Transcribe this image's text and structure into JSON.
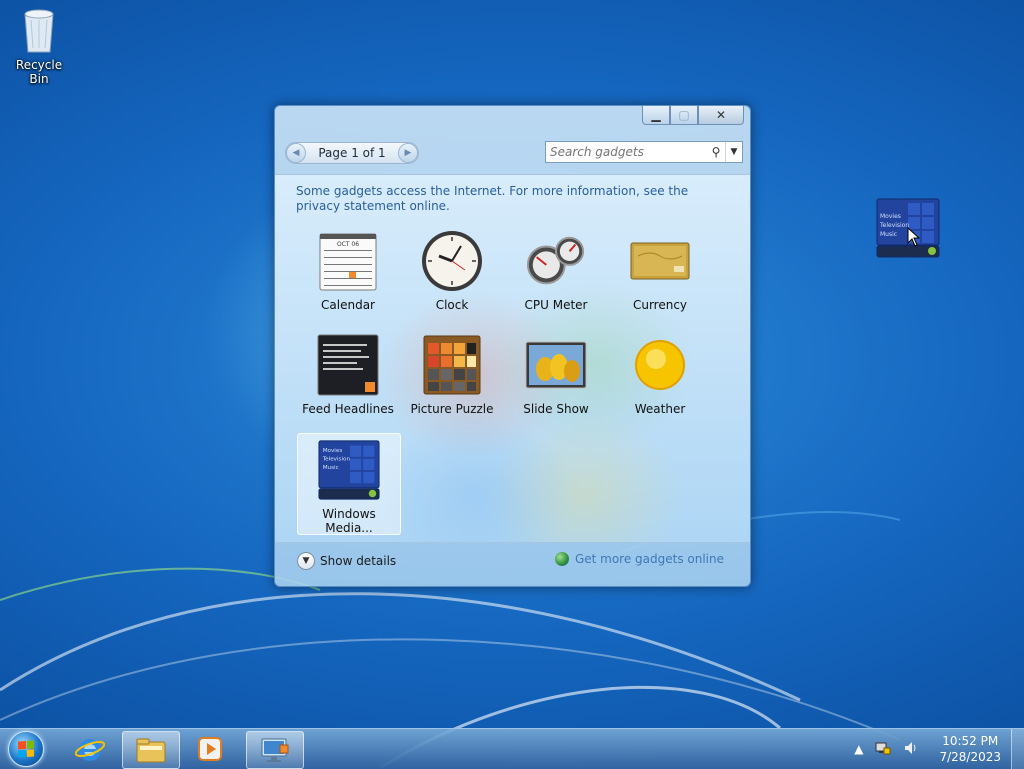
{
  "desktop": {
    "recycle_bin_label": "Recycle Bin"
  },
  "gadget_window": {
    "caption": {
      "minimize_icon": "minimize-icon",
      "maximize_icon": "maximize-icon",
      "close_icon": "close-icon"
    },
    "pager": {
      "label": "Page 1 of 1"
    },
    "search": {
      "placeholder": "Search gadgets"
    },
    "notice": "Some gadgets access the Internet.  For more information, see the privacy statement online.",
    "gadgets": [
      {
        "label": "Calendar",
        "icon": "calendar-icon",
        "calendar_month": "OCT 06"
      },
      {
        "label": "Clock",
        "icon": "clock-icon"
      },
      {
        "label": "CPU Meter",
        "icon": "cpu-meter-icon"
      },
      {
        "label": "Currency",
        "icon": "currency-icon"
      },
      {
        "label": "Feed Headlines",
        "icon": "feed-headlines-icon"
      },
      {
        "label": "Picture Puzzle",
        "icon": "picture-puzzle-icon"
      },
      {
        "label": "Slide Show",
        "icon": "slide-show-icon"
      },
      {
        "label": "Weather",
        "icon": "weather-icon"
      },
      {
        "label": "Windows Media...",
        "icon": "windows-media-center-icon",
        "selected": true
      }
    ],
    "media_center_menu": [
      "Movies",
      "Television",
      "Music"
    ],
    "footer": {
      "show_details": "Show details",
      "get_more": "Get more gadgets online"
    }
  },
  "floating_gadget": {
    "menu": [
      "Movies",
      "Television",
      "Music"
    ]
  },
  "taskbar": {
    "pinned": [
      "start-orb-icon",
      "internet-explorer-icon",
      "file-explorer-icon",
      "media-player-icon",
      "gadgets-icon"
    ],
    "time": "10:52 PM",
    "date": "7/28/2023"
  },
  "colors": {
    "desktop_blue": "#1566bf",
    "link_blue": "#3e78b5",
    "notice_blue": "#2a5f99"
  }
}
